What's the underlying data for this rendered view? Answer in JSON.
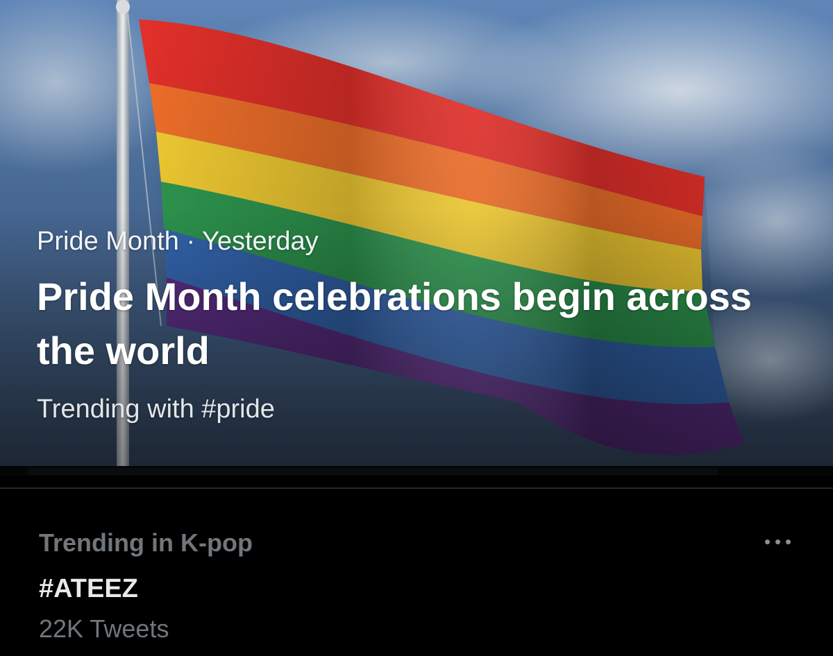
{
  "trending_card": {
    "category": "Pride Month",
    "separator": "·",
    "time": "Yesterday",
    "headline": "Pride Month celebrations begin across the world",
    "subtitle": "Trending with #pride",
    "flag_colors": [
      "#e4302a",
      "#f2702a",
      "#f6cf33",
      "#2f9b51",
      "#3569b5",
      "#5d2f86"
    ]
  },
  "trend_item": {
    "context": "Trending in K-pop",
    "hashtag": "#ATEEZ",
    "tweet_count": "22K Tweets",
    "more_icon": "more-horizontal-icon"
  }
}
